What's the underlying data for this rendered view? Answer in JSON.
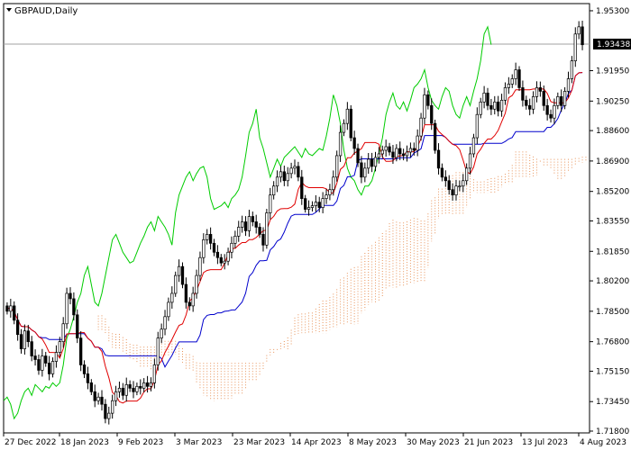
{
  "window": {
    "title": "GBPAUD,Daily",
    "menu_icon": "triangle-down-icon"
  },
  "current_price": "1.93438",
  "colors": {
    "background": "#ffffff",
    "frame": "#000000",
    "candle": "#000000",
    "tenkan": "#e00000",
    "kijun": "#0000cc",
    "chikou": "#00cc00",
    "cloud": "#e8935a",
    "price_line": "#a0a0a0"
  },
  "chart_data": {
    "type": "candlestick",
    "title": "GBPAUD,Daily",
    "yticks": [
      "1.95300",
      "1.93438",
      "1.91950",
      "1.90250",
      "1.88600",
      "1.86900",
      "1.85200",
      "1.83550",
      "1.81850",
      "1.80200",
      "1.78500",
      "1.76800",
      "1.75150",
      "1.73450",
      "1.71800"
    ],
    "ytick_values": [
      1.953,
      1.93438,
      1.9195,
      1.9025,
      1.886,
      1.869,
      1.852,
      1.8355,
      1.8185,
      1.802,
      1.785,
      1.768,
      1.7515,
      1.7345,
      1.718
    ],
    "xticks": [
      "27 Dec 2022",
      "18 Jan 2023",
      "9 Feb 2023",
      "3 Mar 2023",
      "23 Mar 2023",
      "14 Apr 2023",
      "8 May 2023",
      "30 May 2023",
      "21 Jun 2023",
      "13 Jul 2023",
      "4 Aug 2023"
    ],
    "ylim": [
      1.717,
      1.957
    ],
    "indicators": [
      "Tenkan-sen",
      "Kijun-sen",
      "Chikou Span",
      "Ichimoku Cloud"
    ],
    "closes": [
      1.785,
      1.788,
      1.78,
      1.772,
      1.764,
      1.774,
      1.768,
      1.76,
      1.758,
      1.752,
      1.76,
      1.756,
      1.75,
      1.757,
      1.762,
      1.768,
      1.778,
      1.795,
      1.792,
      1.783,
      1.77,
      1.755,
      1.75,
      1.745,
      1.74,
      1.735,
      1.737,
      1.733,
      1.725,
      1.728,
      1.735,
      1.74,
      1.742,
      1.738,
      1.744,
      1.742,
      1.74,
      1.743,
      1.742,
      1.745,
      1.743,
      1.745,
      1.755,
      1.77,
      1.775,
      1.782,
      1.79,
      1.795,
      1.805,
      1.81,
      1.8,
      1.79,
      1.788,
      1.795,
      1.805,
      1.815,
      1.825,
      1.828,
      1.823,
      1.818,
      1.815,
      1.812,
      1.813,
      1.818,
      1.823,
      1.827,
      1.832,
      1.835,
      1.83,
      1.838,
      1.835,
      1.832,
      1.828,
      1.822,
      1.84,
      1.85,
      1.855,
      1.86,
      1.863,
      1.858,
      1.862,
      1.865,
      1.866,
      1.86,
      1.848,
      1.842,
      1.843,
      1.844,
      1.846,
      1.843,
      1.848,
      1.85,
      1.853,
      1.86,
      1.872,
      1.885,
      1.89,
      1.898,
      1.882,
      1.876,
      1.868,
      1.86,
      1.865,
      1.87,
      1.866,
      1.871,
      1.873,
      1.875,
      1.877,
      1.874,
      1.871,
      1.876,
      1.873,
      1.872,
      1.874,
      1.876,
      1.875,
      1.883,
      1.893,
      1.906,
      1.9,
      1.89,
      1.875,
      1.865,
      1.86,
      1.858,
      1.853,
      1.85,
      1.855,
      1.855,
      1.858,
      1.865,
      1.873,
      1.882,
      1.895,
      1.902,
      1.907,
      1.9,
      1.898,
      1.902,
      1.897,
      1.903,
      1.91,
      1.912,
      1.915,
      1.92,
      1.91,
      1.903,
      1.9,
      1.898,
      1.905,
      1.91,
      1.908,
      1.9,
      1.895,
      1.893,
      1.9,
      1.905,
      1.9,
      1.908,
      1.915,
      1.925,
      1.94,
      1.944,
      1.934
    ]
  }
}
